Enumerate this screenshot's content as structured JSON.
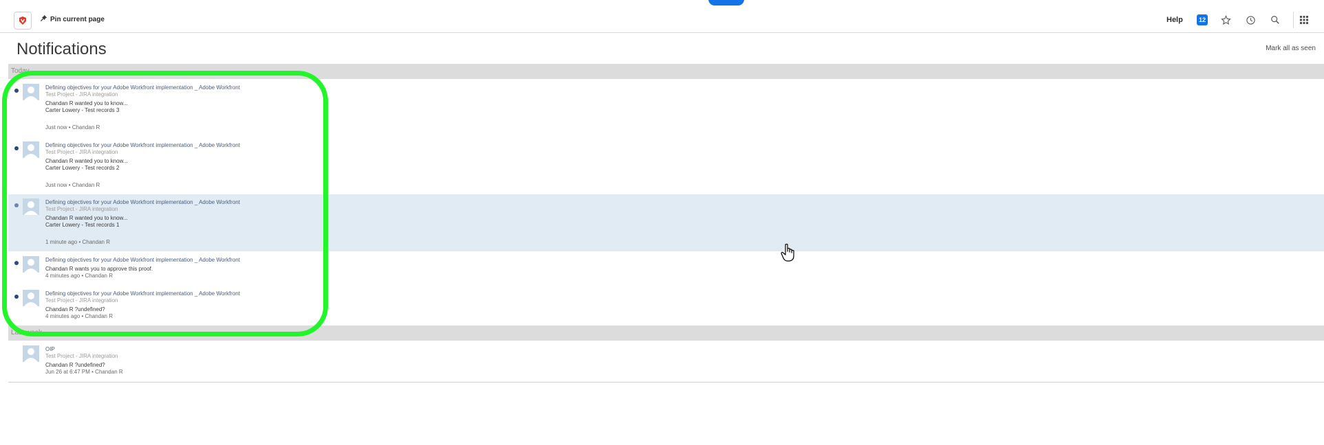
{
  "topbar": {
    "pin_label": "Pin current page",
    "help_label": "Help",
    "badge_count": "12",
    "icons": [
      "logo-icon",
      "pin-icon",
      "star-icon",
      "history-icon",
      "search-icon",
      "apps-grid-icon"
    ],
    "accent_color": "#1473e6"
  },
  "page": {
    "title": "Notifications",
    "mark_all_label": "Mark all as seen"
  },
  "sections": {
    "today_label": "Today",
    "last_week_label": "Last week"
  },
  "today": [
    {
      "title": "Defining objectives for your Adobe Workfront implementation _ Adobe Workfront",
      "project": "Test Project - JIRA integration",
      "msg1": "Chandan R wanted you to know...",
      "msg2": "Carter Lowery   - Test records 3",
      "meta": "Just now • Chandan R",
      "unread": true
    },
    {
      "title": "Defining objectives for your Adobe Workfront implementation _ Adobe Workfront",
      "project": "Test Project - JIRA integration",
      "msg1": "Chandan R wanted you to know...",
      "msg2": "Carter Lowery  - Test records 2",
      "meta": "Just now • Chandan R",
      "unread": true
    },
    {
      "title": "Defining objectives for your Adobe Workfront implementation _ Adobe Workfront",
      "project": "Test Project - JIRA integration",
      "msg1": "Chandan R wanted you to know...",
      "msg2": "Carter Lowery  - Test records 1",
      "meta": "1 minute ago • Chandan R",
      "unread": true
    },
    {
      "title": "Defining objectives for your Adobe Workfront implementation _ Adobe Workfront",
      "msg1": "Chandan R wants you to approve this proof.",
      "meta": "4 minutes ago • Chandan R",
      "unread": true
    },
    {
      "title": "Defining objectives for your Adobe Workfront implementation _ Adobe Workfront",
      "project": "Test Project - JIRA integration",
      "msg1": "Chandan R ?undefined?",
      "meta": "4 minutes ago • Chandan R",
      "unread": true
    }
  ],
  "last_week": [
    {
      "title": "OIP",
      "project": "Test Project - JIRA integration",
      "msg1": "Chandan R ?undefined?",
      "meta": "Jun 26 at 6:47 PM • Chandan R",
      "unread": false
    }
  ],
  "colors": {
    "highlight": "#22f52a",
    "selected_row": "#e1ebf4",
    "section_header": "#dcdcdc"
  }
}
